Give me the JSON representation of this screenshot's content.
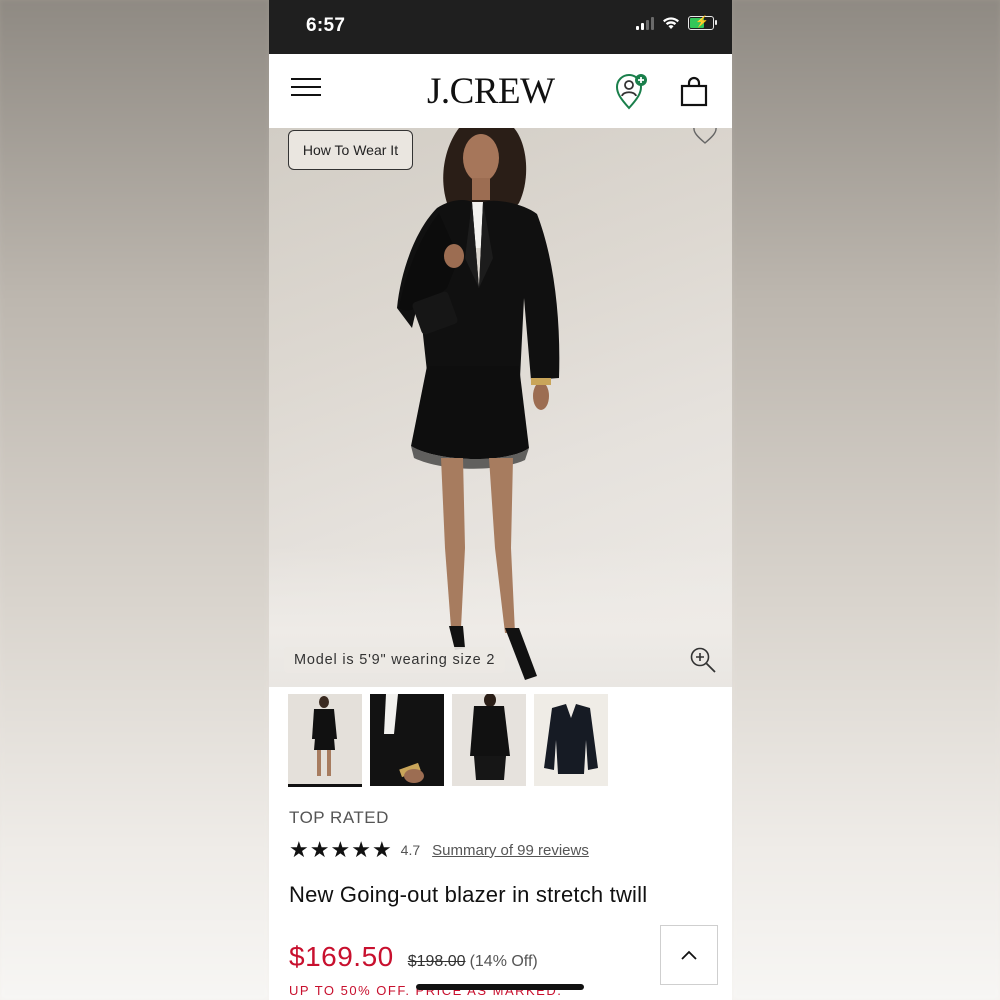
{
  "status_bar": {
    "time": "6:57",
    "icons": [
      "cellular-signal-icon",
      "wifi-icon",
      "battery-charging-icon"
    ]
  },
  "header": {
    "menu_icon": "hamburger-menu-icon",
    "logo": "J.CREW",
    "account_icon": "account-location-icon",
    "bag_icon": "shopping-bag-icon"
  },
  "hero": {
    "how_to_wear_label": "How To Wear It",
    "model_caption": "Model is 5'9\" wearing size 2",
    "wishlist_icon": "heart-icon",
    "zoom_icon": "zoom-in-icon"
  },
  "thumbnails": [
    {
      "name": "full-look",
      "active": true
    },
    {
      "name": "hand-detail",
      "active": false
    },
    {
      "name": "side-view",
      "active": false
    },
    {
      "name": "flat-lay",
      "active": false
    }
  ],
  "product": {
    "badge": "TOP RATED",
    "rating": "4.7",
    "stars": 5,
    "reviews_link": "Summary of 99 reviews",
    "name": "New Going-out blazer in stretch twill",
    "sale_price": "$169.50",
    "original_price": "$198.00",
    "discount": "(14% Off)",
    "promo": "UP TO 50% OFF. PRICE AS MARKED."
  },
  "colors": {
    "sale_red": "#c8102e",
    "status_bar": "#1f1f1f",
    "account_badge": "#1a7f4b"
  },
  "back_to_top_icon": "chevron-up-icon"
}
